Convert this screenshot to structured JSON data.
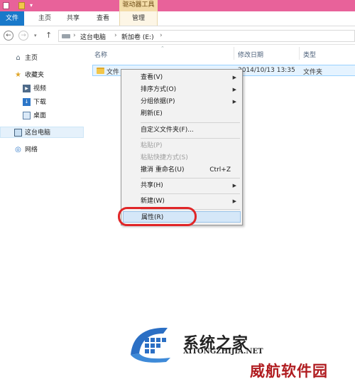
{
  "ribbon": {
    "contextual_tab_header": "驱动器工具",
    "tabs": {
      "file": "文件",
      "home": "主页",
      "share": "共享",
      "view": "查看",
      "manage": "管理"
    }
  },
  "address": {
    "crumbs": [
      "这台电脑",
      "新加卷 (E:)"
    ]
  },
  "nav_pane": {
    "items": [
      {
        "label": "主页",
        "icon": "home-icon"
      },
      {
        "label": "收藏夹",
        "icon": "star-icon"
      },
      {
        "label": "视频",
        "icon": "video-folder-icon"
      },
      {
        "label": "下载",
        "icon": "download-folder-icon"
      },
      {
        "label": "桌面",
        "icon": "desktop-icon"
      },
      {
        "label": "这台电脑",
        "icon": "computer-icon"
      },
      {
        "label": "网络",
        "icon": "network-icon"
      }
    ]
  },
  "file_list": {
    "columns": {
      "name": "名称",
      "date": "修改日期",
      "type": "类型"
    },
    "rows": [
      {
        "name": "文件",
        "date": "2014/10/13 13:35",
        "type": "文件夹"
      }
    ]
  },
  "context_menu": {
    "items": [
      {
        "label": "查看(V)"
      },
      {
        "label": "排序方式(O)"
      },
      {
        "label": "分组依据(P)"
      },
      {
        "label": "刷新(E)"
      },
      {
        "label": "自定义文件夹(F)..."
      },
      {
        "label": "粘贴(P)"
      },
      {
        "label": "粘贴快捷方式(S)"
      },
      {
        "label": "撤消 重命名(U)",
        "shortcut": "Ctrl+Z"
      },
      {
        "label": "共享(H)"
      },
      {
        "label": "新建(W)"
      },
      {
        "label": "属性(R)"
      }
    ],
    "highlight_color": "#e02628"
  },
  "watermark": {
    "logo_text": "系统之家",
    "logo_url": "XITONGZHIJIA.NET",
    "secondary_text": "威航软件园"
  }
}
